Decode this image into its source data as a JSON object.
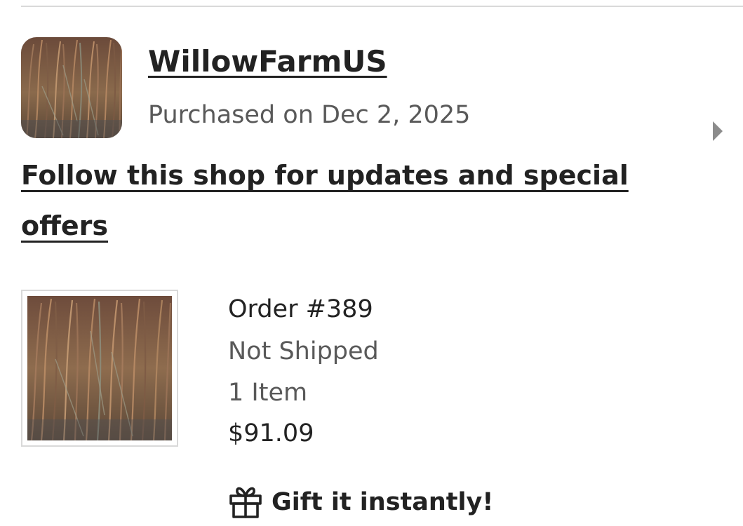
{
  "shop": {
    "name": "WillowFarmUS",
    "purchased": "Purchased on Dec 2, 2025",
    "follow_text": "Follow this shop for updates and special offers",
    "avatar_icon": "broomcorn-photo",
    "chevron_icon": "chevron-right-icon"
  },
  "order": {
    "number": "Order #389",
    "status": "Not Shipped",
    "items": "1 Item",
    "total": "$91.09",
    "thumbnail_icon": "broomcorn-photo"
  },
  "gift": {
    "label": "Gift it instantly!",
    "icon": "gift-icon"
  },
  "colors": {
    "text_primary": "#222222",
    "text_secondary": "#595959",
    "divider": "#d9d9d9",
    "chevron": "#8c8c8c"
  }
}
